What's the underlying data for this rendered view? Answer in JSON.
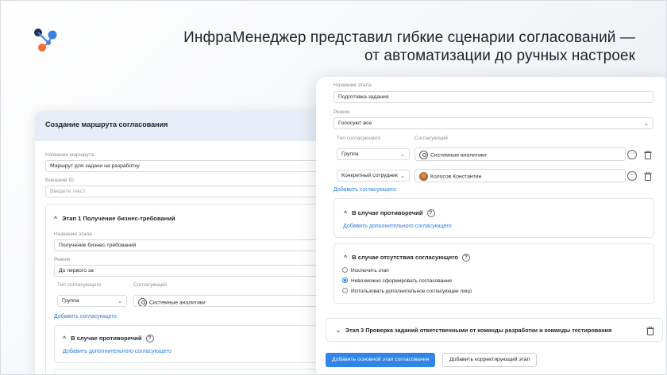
{
  "headline": {
    "line1": "ИнфраМенеджер представил гибкие сценарии согласований —",
    "line2": "от автоматизации до ручных настроек"
  },
  "colors": {
    "accent": "#2f86e6",
    "logo_blue": "#3d7fe6",
    "logo_orange": "#f26b3a",
    "logo_navy": "#233152"
  },
  "back_card": {
    "title": "Создание маршрута согласования",
    "route_name_label": "Название маршрута",
    "route_name_value": "Маршрут для задачи на разработку",
    "external_id_label": "Внешний ID",
    "external_id_placeholder": "Введите текст",
    "stage1": {
      "title": "Этап 1 Получение бизнес-требований",
      "name_label": "Название этапа",
      "name_value": "Получение бизнес-требований",
      "mode_label": "Режим",
      "mode_value": "До первого за",
      "approver_type_label": "Тип согласующего",
      "approvers_label": "Согласующий",
      "approver_type_value": "Группа",
      "approver_value": "Системные аналитики",
      "add_approver": "Добавить согласующего",
      "conflict_title": "В случае противоречий",
      "add_extra_approver": "Добавить дополнительного согласующего"
    }
  },
  "front_card": {
    "stage_name_label": "Название этапа",
    "stage_name_value": "Подготовка задания",
    "mode_label": "Режим",
    "mode_value": "Голосуют все",
    "approver_type_label": "Тип согласующего",
    "approvers_label": "Согласующий",
    "rows": [
      {
        "type": "Группа",
        "approver": "Системные аналитики"
      },
      {
        "type": "Конкретный сотрудник",
        "approver": "Колосов Константин"
      }
    ],
    "add_approver": "Добавить согласующего",
    "conflict_title": "В случае противоречий",
    "add_extra_approver": "Добавить дополнительного согласующего",
    "absence_title": "В случае отсутствия согласующего",
    "options": [
      "Исключить этап",
      "Невозможно сформировать согласование",
      "Использовать дополнительное согласующее лицо"
    ],
    "selected_option": 1,
    "stage3_title": "Этап 3 Проверка заданий ответственными от команды разработки и команды тестирования",
    "add_main_stage_button": "Добавить основной этап согласования",
    "add_corrective_stage_button": "Добавить корректирующий этап"
  },
  "icons": [
    "logo-icon",
    "person-group-icon",
    "user-avatar-icon",
    "more-icon",
    "trash-icon",
    "chevron-down-icon",
    "chevron-up-icon",
    "help-icon"
  ]
}
